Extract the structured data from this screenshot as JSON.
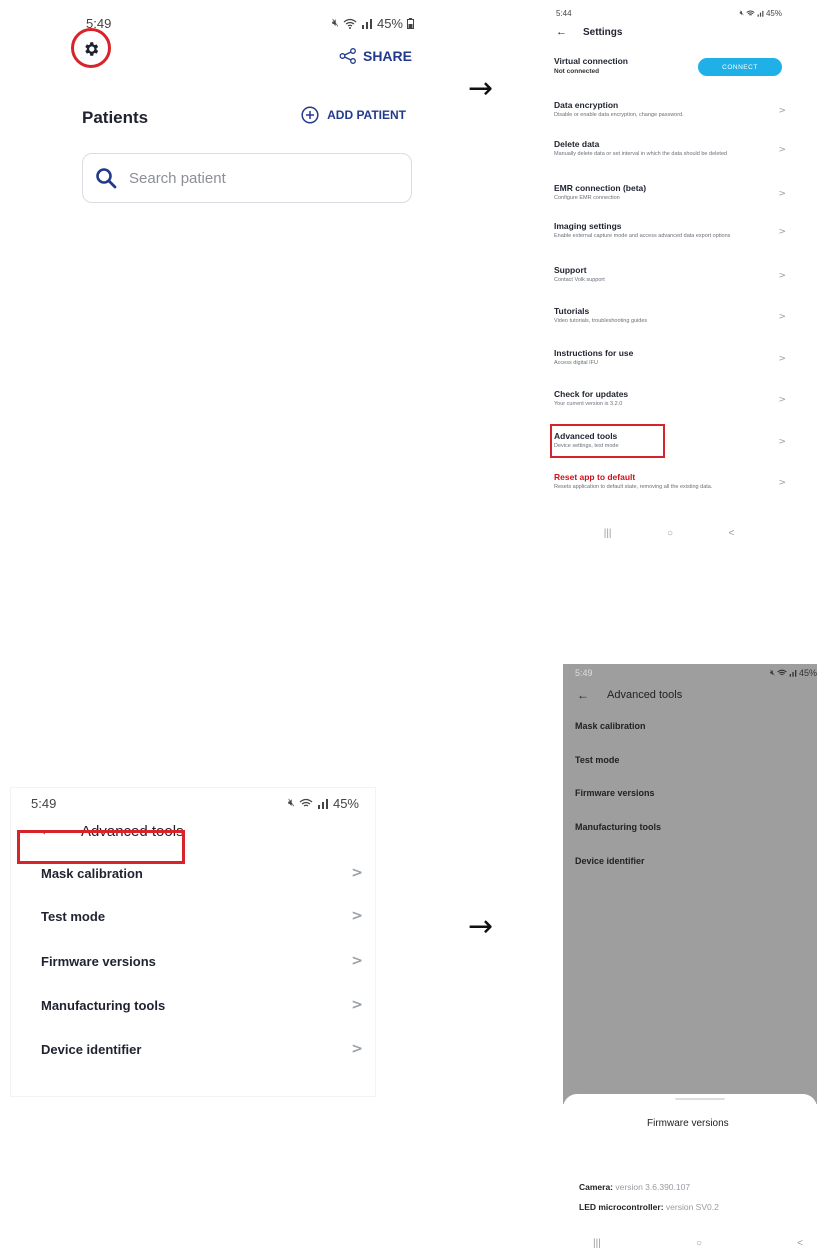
{
  "arrows": [
    "→",
    "→"
  ],
  "patients_screen": {
    "time": "5:49",
    "battery": "45%",
    "share_label": "SHARE",
    "title": "Patients",
    "add_patient_label": "ADD PATIENT",
    "search_placeholder": "Search patient"
  },
  "settings_screen": {
    "time": "5:44",
    "battery": "45%",
    "title": "Settings",
    "virtual_connection": {
      "title": "Virtual connection",
      "status": "Not connected",
      "button": "CONNECT"
    },
    "items": [
      {
        "title": "Data encryption",
        "desc": "Disable or enable data encryption, change password."
      },
      {
        "title": "Delete data",
        "desc": "Manually delete data or set interval in which the data should be deleted"
      },
      {
        "title": "EMR connection (beta)",
        "desc": "Configure EMR connection"
      },
      {
        "title": "Imaging settings",
        "desc": "Enable external capture mode and access advanced data export options"
      },
      {
        "title": "Support",
        "desc": "Contact Volk support"
      },
      {
        "title": "Tutorials",
        "desc": "Video tutorials, troubleshooting guides"
      },
      {
        "title": "Instructions for use",
        "desc": "Access digital IFU"
      },
      {
        "title": "Check for updates",
        "desc": "Your current version is 3.2.0"
      },
      {
        "title": "Advanced tools",
        "desc": "Device settings, test mode"
      },
      {
        "title": "Reset app to default",
        "desc": "Resets application to default state, removing all the existing data."
      }
    ],
    "nav": [
      "|||",
      "○",
      "<"
    ]
  },
  "advanced_screen": {
    "time": "5:49",
    "battery": "45%",
    "title": "Advanced tools",
    "items": [
      "Mask calibration",
      "Test mode",
      "Firmware versions",
      "Manufacturing tools",
      "Device identifier"
    ]
  },
  "firmware_screen": {
    "time": "5:49",
    "battery": "45%",
    "title": "Advanced tools",
    "items": [
      "Mask calibration",
      "Test mode",
      "Firmware versions",
      "Manufacturing tools",
      "Device identifier"
    ],
    "sheet_title": "Firmware versions",
    "camera_label": "Camera:",
    "camera_value": "version 3.6.390.107",
    "led_label": "LED microcontroller:",
    "led_value": "version SV0.2",
    "nav": [
      "|||",
      "○",
      "<"
    ]
  },
  "colors": {
    "brand_blue": "#233a8c",
    "connect_blue": "#1fb0e8",
    "highlight_red": "#d8232a",
    "reset_red": "#d0101a"
  }
}
